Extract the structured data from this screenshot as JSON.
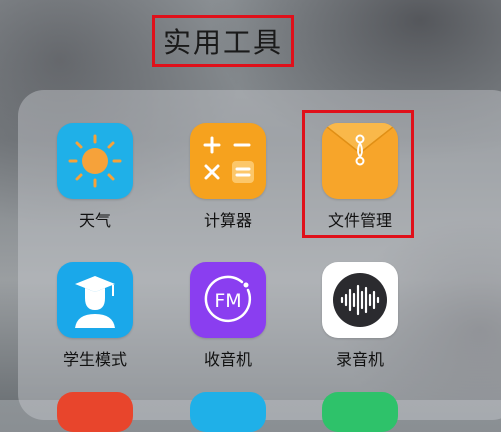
{
  "folder": {
    "title": "实用工具"
  },
  "apps": [
    {
      "label": "天气",
      "icon": "sun-icon",
      "color": "#1fb0e8"
    },
    {
      "label": "计算器",
      "icon": "calculator-icon",
      "color": "#f6a21e"
    },
    {
      "label": "文件管理",
      "icon": "envelope-icon",
      "color": "#f7a52a"
    },
    {
      "label": "学生模式",
      "icon": "graduate-icon",
      "color": "#1aa8ea"
    },
    {
      "label": "收音机",
      "icon": "fm-radio-icon",
      "color": "#8a3ef0"
    },
    {
      "label": "录音机",
      "icon": "sound-wave-icon",
      "color": "#ffffff"
    }
  ],
  "partial_row_colors": [
    "#e8452c",
    "#1fb0e8",
    "#2ec26a"
  ],
  "highlight_color": "#e0101a"
}
